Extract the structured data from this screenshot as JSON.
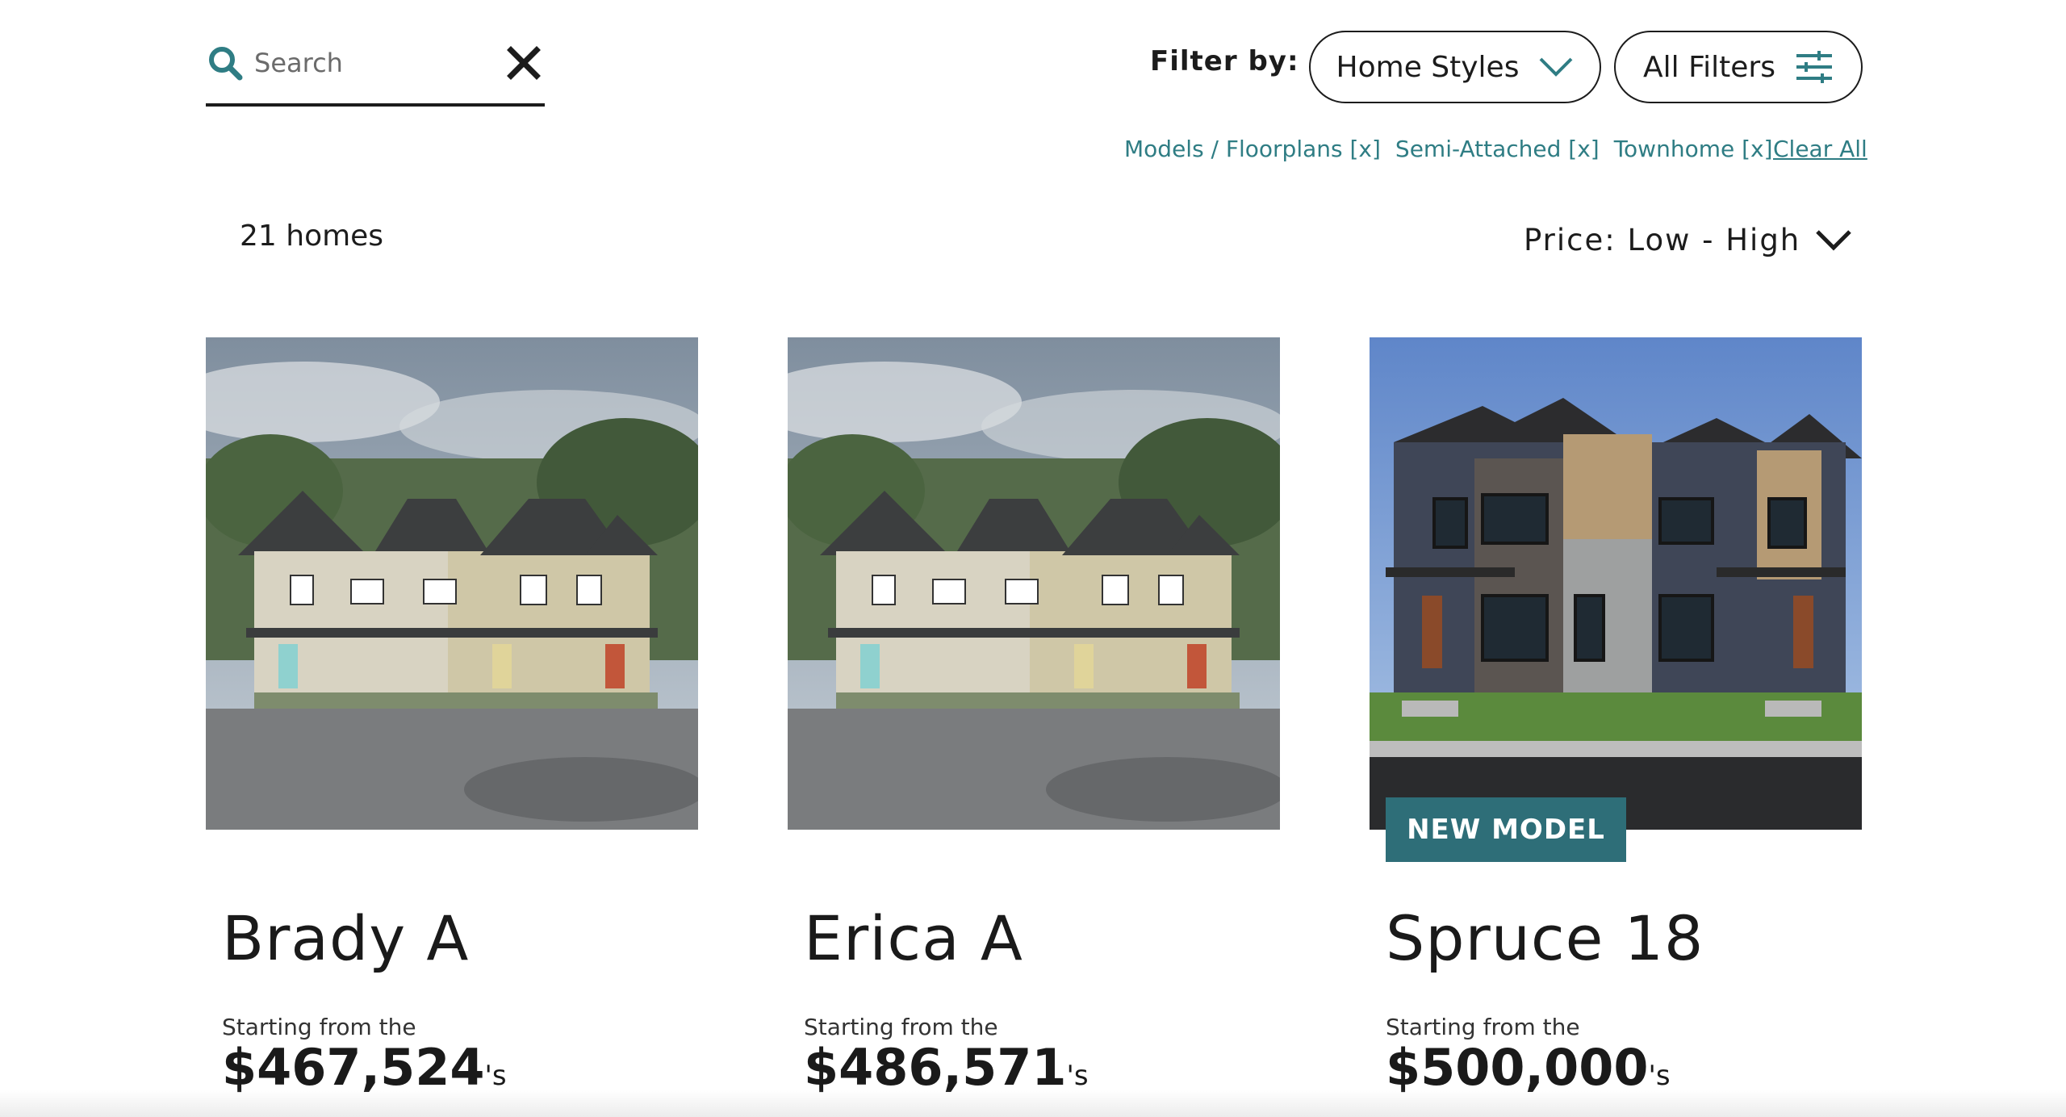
{
  "search": {
    "placeholder": "Search"
  },
  "filter": {
    "label": "Filter by:",
    "home_styles_label": "Home Styles",
    "all_filters_label": "All Filters",
    "active_filters": [
      "Models / Floorplans [x]",
      "Semi-Attached [x]",
      "Townhome [x]"
    ],
    "clear_all_label": "Clear All"
  },
  "results": {
    "count_label": "21 homes",
    "sort_label": "Price: Low - High"
  },
  "colors": {
    "accent_teal": "#2f7d84",
    "badge_teal": "#2e6e78",
    "text_dark": "#1c1c1c"
  },
  "cards": [
    {
      "name": "Brady A",
      "from_label": "Starting from the",
      "price": "$467,524",
      "price_suffix": "'s",
      "badge": ""
    },
    {
      "name": "Erica A",
      "from_label": "Starting from the",
      "price": "$486,571",
      "price_suffix": "'s",
      "badge": ""
    },
    {
      "name": "Spruce 18",
      "from_label": "Starting from the",
      "price": "$500,000",
      "price_suffix": "'s",
      "badge": "NEW MODEL"
    }
  ]
}
